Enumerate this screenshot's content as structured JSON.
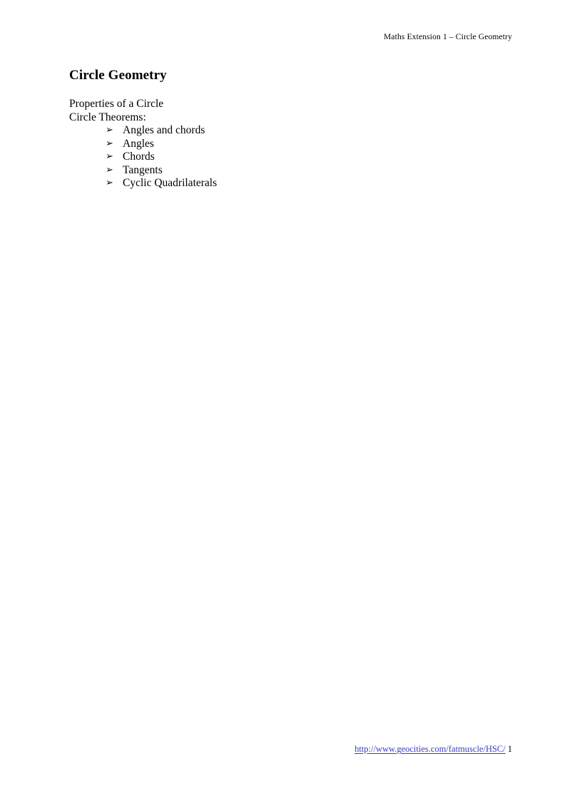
{
  "document": {
    "header_text": "Maths Extension 1 – Circle Geometry",
    "title": "Circle Geometry",
    "intro_lines": [
      "Properties of a Circle",
      "Circle Theorems:"
    ],
    "bullet_glyph": "➢",
    "theorems": [
      "Angles and chords",
      "Angles",
      "Chords",
      "Tangents",
      "Cyclic Quadrilaterals"
    ],
    "footer": {
      "link_text": "http://www.geocities.com/fatmuscle/HSC/",
      "page_number": "1",
      "link_color": "#3a3ac8"
    },
    "colors": {
      "page_background": "#ffffff",
      "text": "#000000"
    }
  }
}
